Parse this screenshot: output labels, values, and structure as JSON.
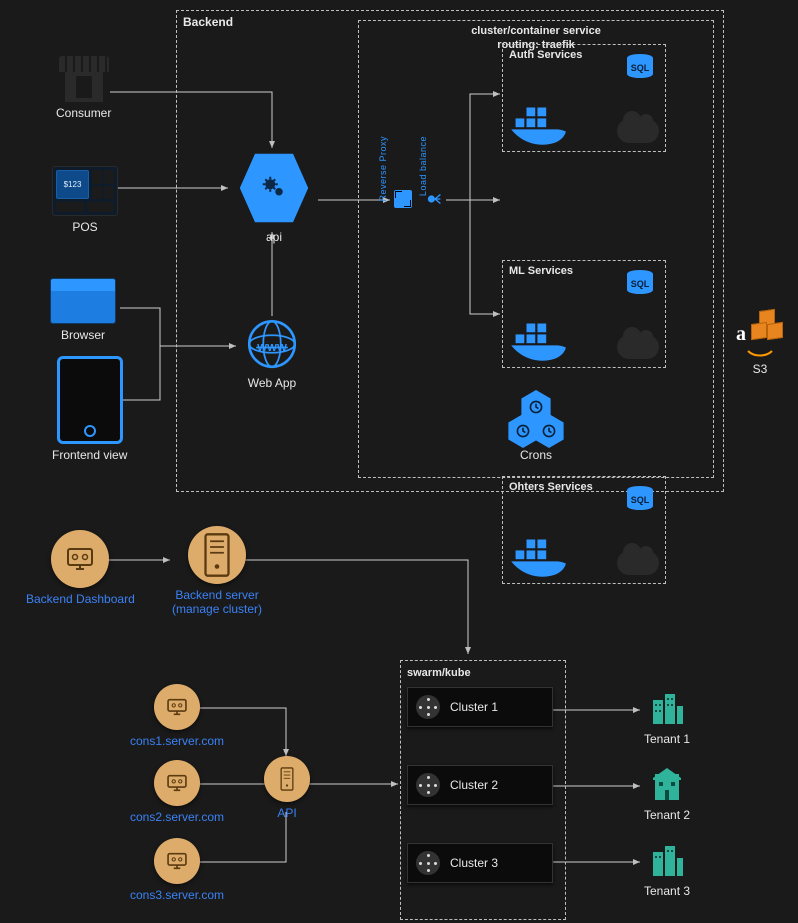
{
  "top": {
    "backend_box_title": "Backend",
    "cluster_box_title": "cluster/container service",
    "cluster_box_subtitle": "routing: traefik",
    "consumer": "Consumer",
    "pos_screen": "$123",
    "pos_label": "POS",
    "browser_label": "Browser",
    "frontend_label": "Frontend view",
    "api_label": "api",
    "webapp_label": "Web App",
    "reverse_proxy_label": "Reverse Proxy",
    "load_balance_label": "Load balance",
    "services": [
      {
        "title": "Auth Services",
        "db": "SQL"
      },
      {
        "title": "ML Services",
        "db": "SQL"
      },
      {
        "title": "Ohters Services",
        "db": "SQL"
      }
    ],
    "crons_label": "Crons",
    "s3_label": "S3"
  },
  "mid": {
    "backend_dashboard": "Backend Dashboard",
    "backend_server_line1": "Backend server",
    "backend_server_line2": "(manage cluster)"
  },
  "bottom": {
    "swarm_title": "swarm/kube",
    "consumers": [
      "cons1.server.com",
      "cons2.server.com",
      "cons3.server.com"
    ],
    "api_label": "API",
    "clusters": [
      "Cluster 1",
      "Cluster 2",
      "Cluster 3"
    ],
    "tenants": [
      "Tenant 1",
      "Tenant 2",
      "Tenant 3"
    ]
  }
}
